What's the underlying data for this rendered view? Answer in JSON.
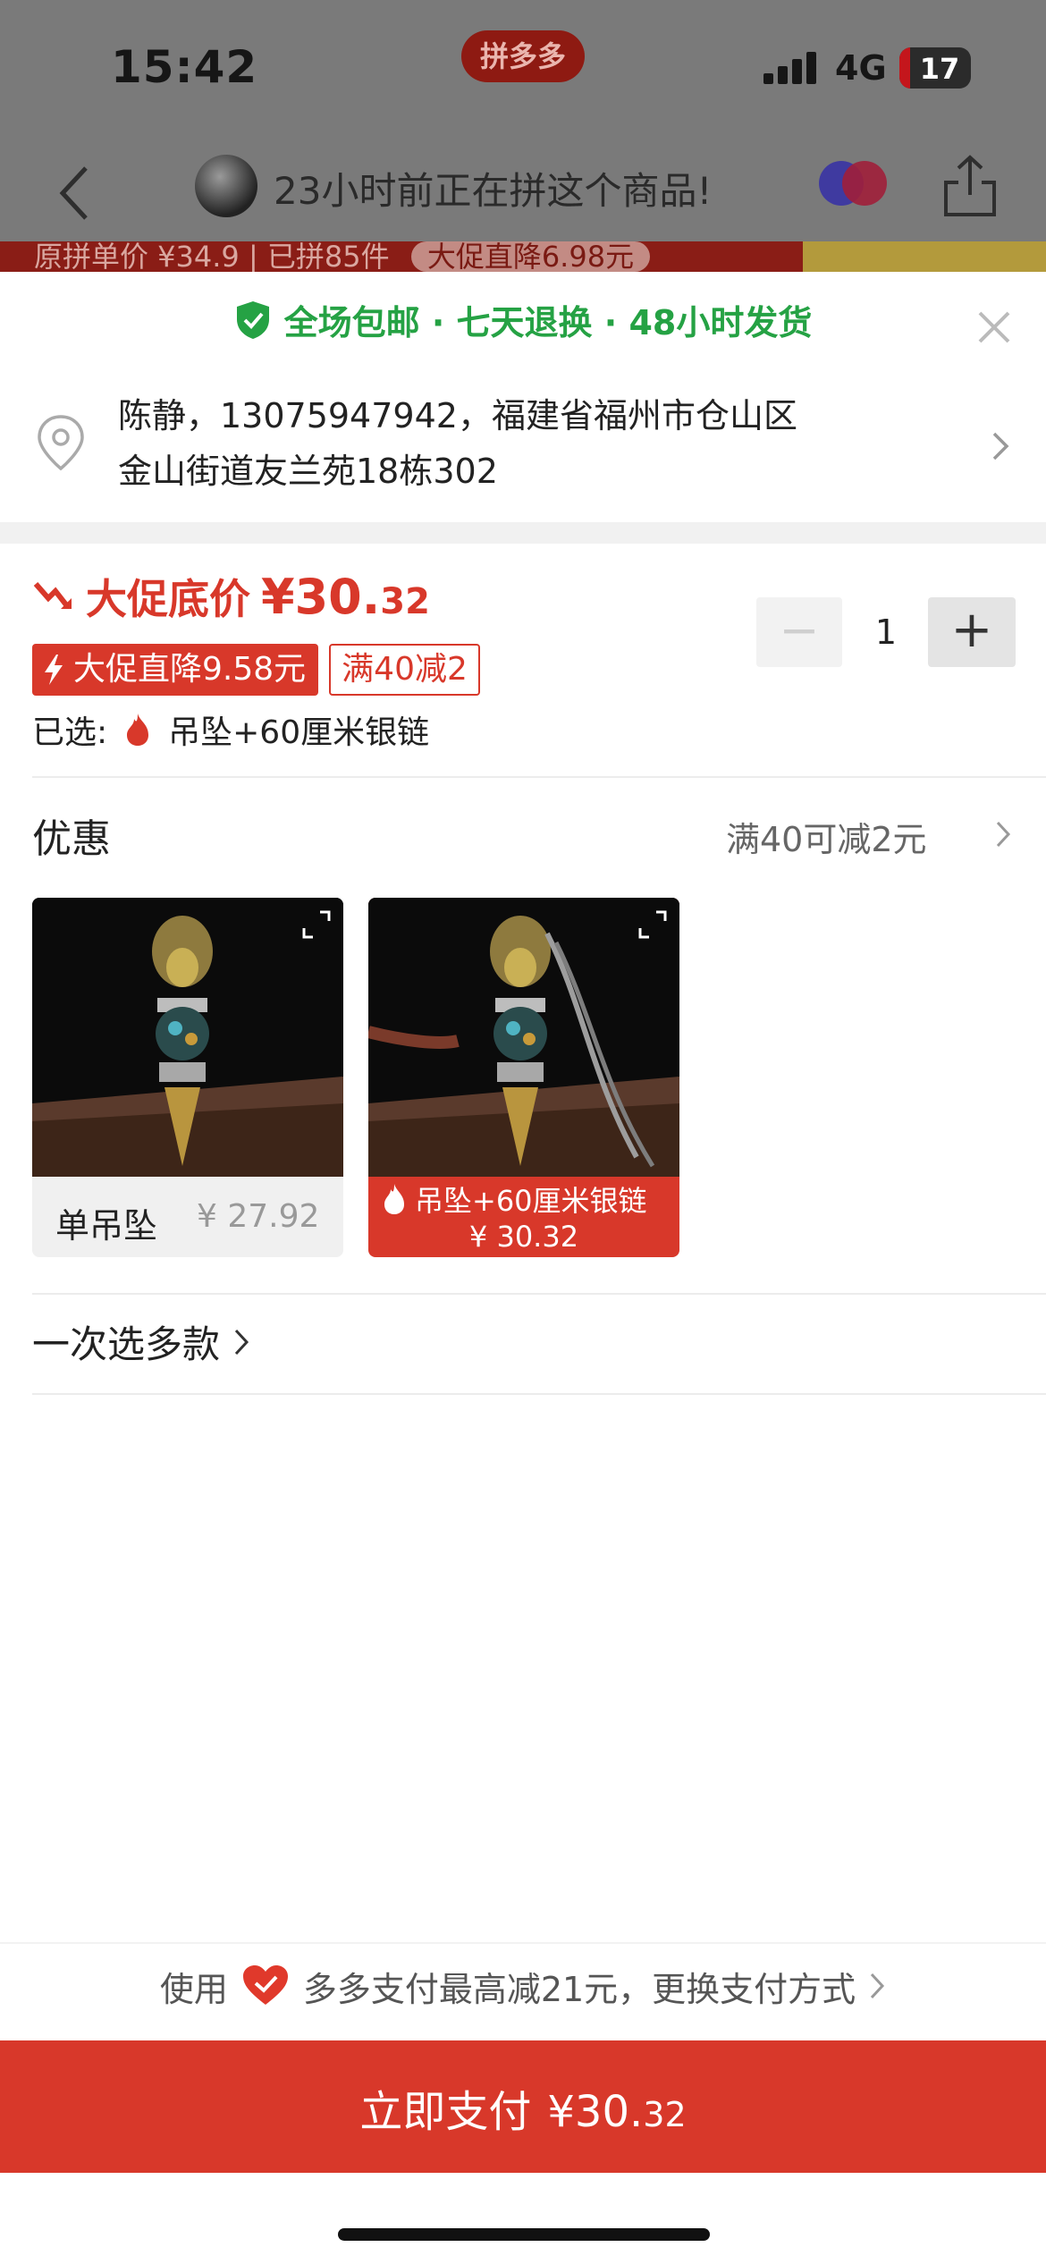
{
  "status_bar": {
    "time": "15:42",
    "center_badge": "拼多多",
    "network": "4G",
    "battery": "17"
  },
  "background_nav": {
    "group_text": "23小时前正在拼这个商品!",
    "promo_text": "原拼单价 ¥34.9 | 已拼85件",
    "promo_pill": "大促直降6.98元"
  },
  "sheet": {
    "guarantee_text": "全场包邮 · 七天退换 · 48小时发货",
    "address": {
      "line1": "陈静，13075947942，福建省福州市仓山区",
      "line2": "金山街道友兰苑18栋302"
    },
    "price": {
      "label": "大促底价",
      "big": "¥30.",
      "small": "32"
    },
    "quantity": {
      "minus": "−",
      "value": "1",
      "plus": "+"
    },
    "badges": {
      "flash": "大促直降9.58元",
      "coupon": "满40减2"
    },
    "selected": {
      "label": "已选:",
      "value": "吊坠+60厘米银链"
    },
    "offer": {
      "label": "优惠",
      "value": "满40可减2元"
    },
    "variants": [
      {
        "name": "单吊坠",
        "price": "¥ 27.92",
        "selected": false
      },
      {
        "name": "吊坠+60厘米银链",
        "price": "¥ 30.32",
        "selected": true
      }
    ],
    "multi_select": "一次选多款",
    "pay_tip": {
      "prefix": "使用",
      "text": "多多支付最高减21元，更换支付方式"
    },
    "pay_button": {
      "label": "立即支付",
      "amount_big": "¥30.",
      "amount_small": "32"
    }
  },
  "colors": {
    "accent": "#d8382a",
    "guarantee": "#25a244"
  }
}
